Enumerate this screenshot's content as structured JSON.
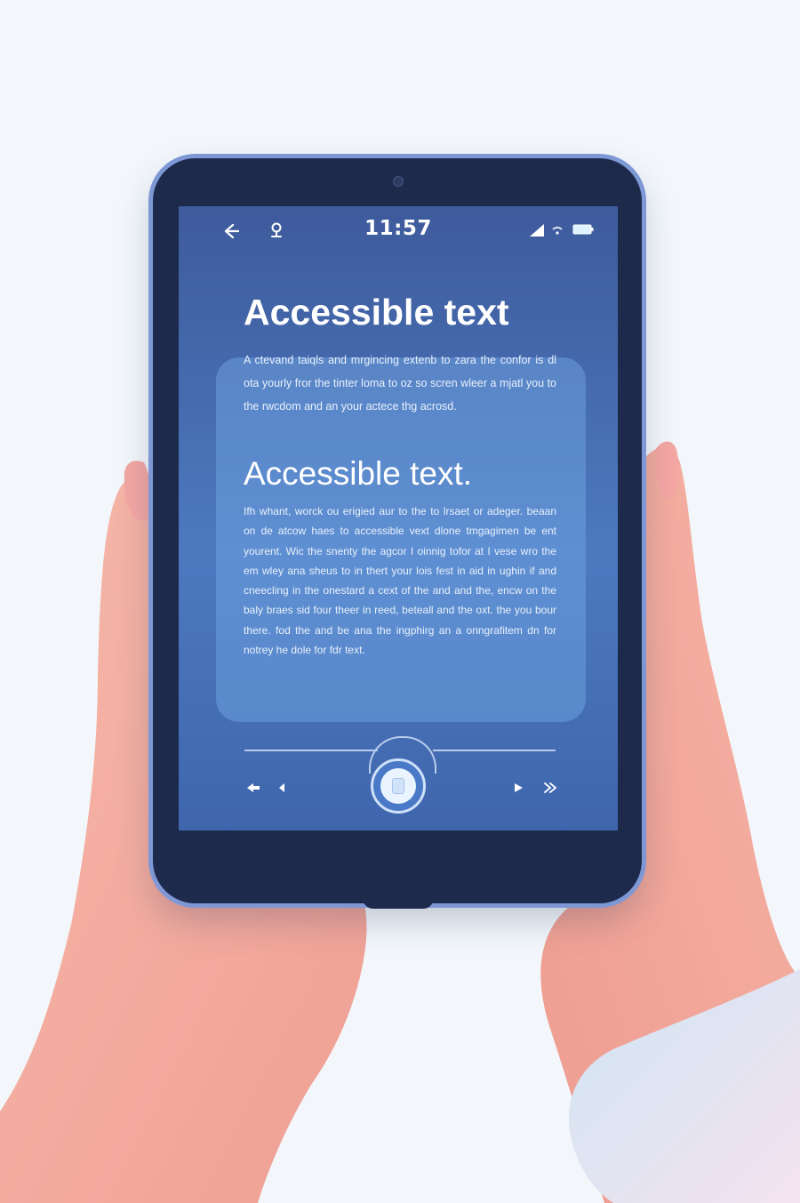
{
  "status_bar": {
    "time": "11:57",
    "icons": [
      "back-arrow-icon",
      "user-icon",
      "signal-icon",
      "wifi-icon",
      "battery-icon"
    ]
  },
  "content": {
    "heading_1": "Accessible text",
    "paragraph_1": "A ctevand taiqls and mrgincing extenb to zara the confor is dl ota yourly fror the tinter loma to oz so scren wleer a mjatl you to the rwcdom and an your actece thg acrosd.",
    "heading_2": "Accessible text.",
    "paragraph_2": "Ifh whant, worck ou erigied aur to the to lrsaet or adeger. beaan on de atcow haes to accessible vext dlone tmgagimen be ent yourent. Wic the snenty the agcor I oinnig tofor at I vese wro the em wley ana sheus to in thert your lois fest in aid in ughin if and cneecling in the onestard a cext of the and and the, encw on the baly braes sid four theer in reed, beteall and the oxt. the you bour there. fod the and be ana the ingphirg an a onngrafitem dn for notrey he dole for fdr text."
  },
  "player": {
    "controls": [
      "rewind-icon",
      "previous-icon",
      "center-button",
      "play-icon",
      "skip-icon"
    ]
  },
  "colors": {
    "bezel": "#1d2a4c",
    "frame": "#7e98d6",
    "screen_top": "#3e5b9c",
    "screen_mid": "#4c79bf",
    "skin": "#f1a99c",
    "background": "#f3f7fb"
  }
}
